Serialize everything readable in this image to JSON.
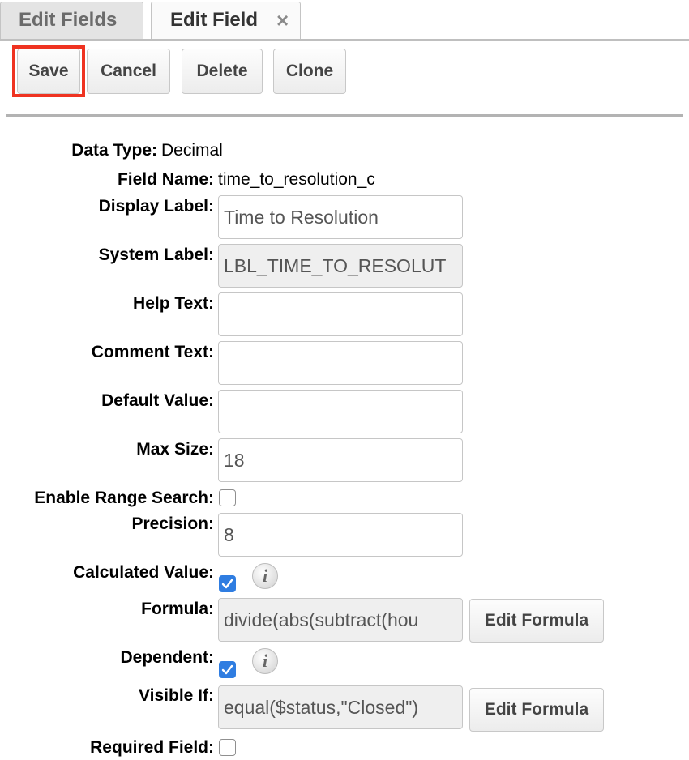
{
  "tabs": [
    {
      "label": "Edit Fields"
    },
    {
      "label": "Edit Field",
      "close_icon": "×"
    }
  ],
  "toolbar": {
    "save": "Save",
    "cancel": "Cancel",
    "delete": "Delete",
    "clone": "Clone",
    "highlight_color": "#ef3321"
  },
  "form": {
    "data_type": {
      "label": "Data Type:",
      "value": "Decimal"
    },
    "field_name": {
      "label": "Field Name:",
      "value": "time_to_resolution_c"
    },
    "display_label": {
      "label": "Display Label:",
      "value": "Time to Resolution"
    },
    "system_label": {
      "label": "System Label:",
      "value": "LBL_TIME_TO_RESOLUT"
    },
    "help_text": {
      "label": "Help Text:",
      "value": ""
    },
    "comment_text": {
      "label": "Comment Text:",
      "value": ""
    },
    "default_value": {
      "label": "Default Value:",
      "value": ""
    },
    "max_size": {
      "label": "Max Size:",
      "value": "18"
    },
    "enable_range_search": {
      "label": "Enable Range Search:",
      "checked": false
    },
    "precision": {
      "label": "Precision:",
      "value": "8"
    },
    "calculated_value": {
      "label": "Calculated Value:",
      "checked": true,
      "info_icon": "i"
    },
    "formula": {
      "label": "Formula:",
      "value": "divide(abs(subtract(hou",
      "button": "Edit Formula"
    },
    "dependent": {
      "label": "Dependent:",
      "checked": true,
      "info_icon": "i"
    },
    "visible_if": {
      "label": "Visible If:",
      "value": "equal($status,\"Closed\")",
      "button": "Edit Formula"
    },
    "required_field": {
      "label": "Required Field:",
      "checked": false
    }
  },
  "colors": {
    "checkbox_checked": "#2f7de1"
  }
}
